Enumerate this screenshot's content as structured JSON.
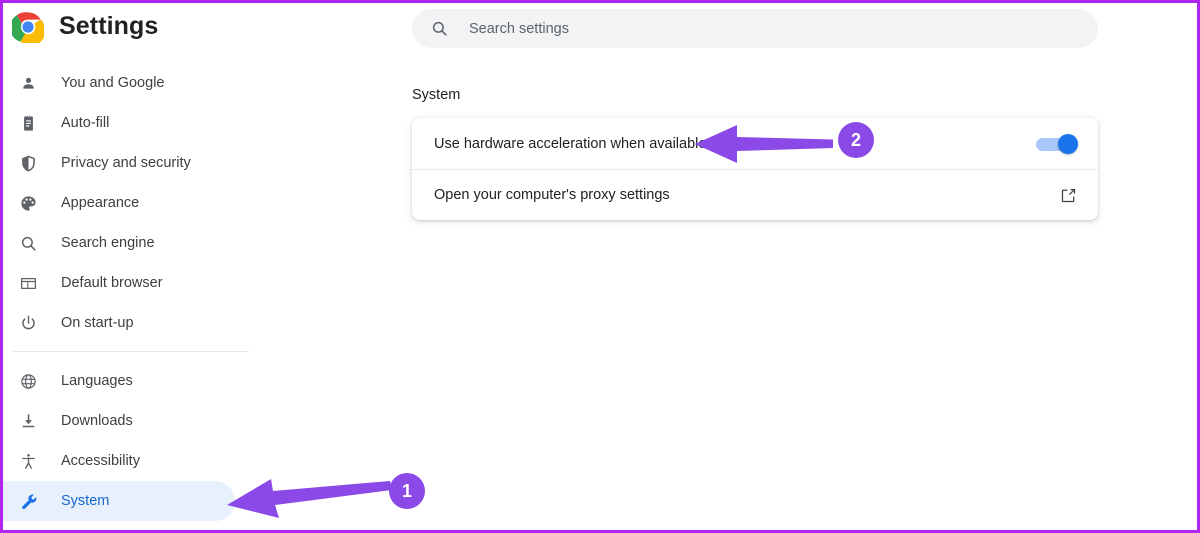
{
  "window": {
    "app_title": "Settings",
    "logo_icon": "chrome-logo-icon",
    "border_color": "#b026f0"
  },
  "search": {
    "icon": "search-icon",
    "placeholder": "Search settings",
    "value": ""
  },
  "sidebar": {
    "groups": [
      {
        "items": [
          {
            "label": "You and Google",
            "icon": "person-icon",
            "active": false
          },
          {
            "label": "Auto-fill",
            "icon": "clipboard-icon",
            "active": false
          },
          {
            "label": "Privacy and security",
            "icon": "shield-icon",
            "active": false
          },
          {
            "label": "Appearance",
            "icon": "palette-icon",
            "active": false
          },
          {
            "label": "Search engine",
            "icon": "search-icon",
            "active": false
          },
          {
            "label": "Default browser",
            "icon": "browser-window-icon",
            "active": false
          },
          {
            "label": "On start-up",
            "icon": "power-icon",
            "active": false
          }
        ]
      },
      {
        "items": [
          {
            "label": "Languages",
            "icon": "globe-icon",
            "active": false
          },
          {
            "label": "Downloads",
            "icon": "download-icon",
            "active": false
          },
          {
            "label": "Accessibility",
            "icon": "accessibility-icon",
            "active": false
          },
          {
            "label": "System",
            "icon": "wrench-icon",
            "active": true
          }
        ]
      }
    ]
  },
  "main": {
    "section_heading": "System",
    "rows": [
      {
        "label": "Use hardware acceleration when available",
        "control": "toggle",
        "toggle_on": true
      },
      {
        "label": "Open your computer's proxy settings",
        "control": "external-link",
        "icon": "external-link-icon"
      }
    ]
  },
  "annotations": {
    "accent_color": "#8b4ae8",
    "markers": [
      {
        "number": "1",
        "target": "sidebar-item-system"
      },
      {
        "number": "2",
        "target": "hardware-acceleration-row"
      }
    ]
  },
  "colors": {
    "active_nav_bg": "#e8f0fe",
    "active_nav_text": "#1967d2",
    "toggle_on": "#1a73e8",
    "search_bg": "#f1f3f4"
  }
}
